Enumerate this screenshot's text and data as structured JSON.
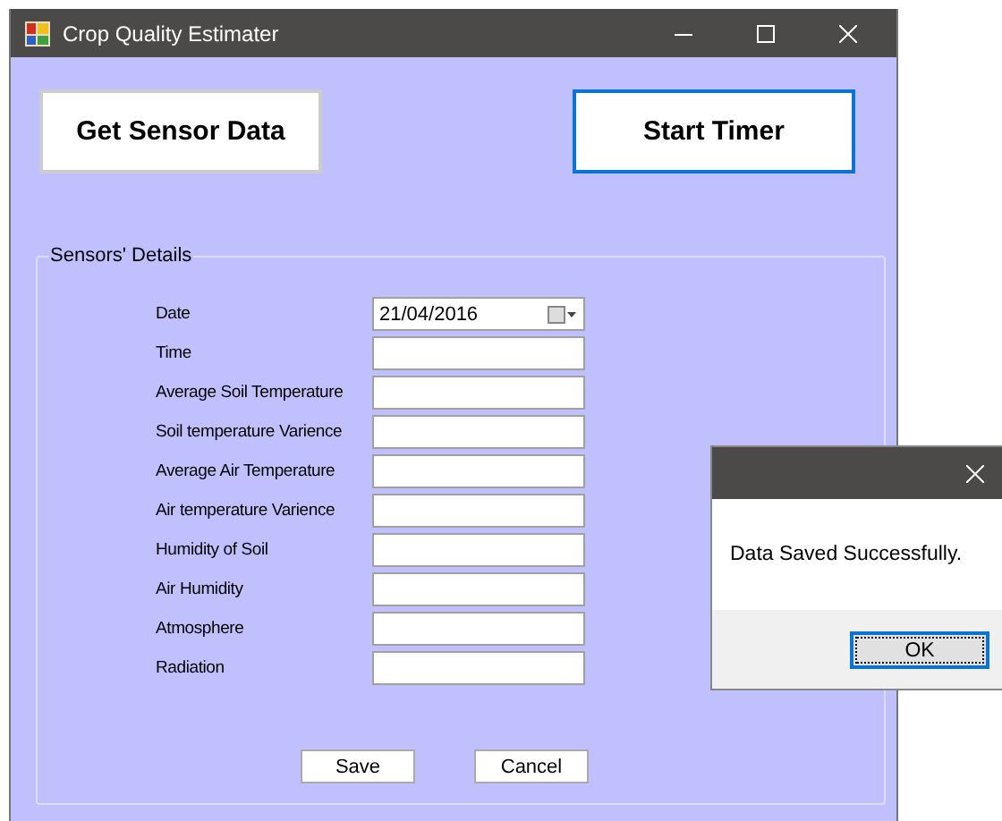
{
  "window": {
    "title": "Crop Quality Estimater"
  },
  "top_buttons": [
    {
      "label": "Get Sensor Data",
      "focused": false
    },
    {
      "label": "Start Timer",
      "focused": true
    }
  ],
  "group": {
    "title": "Sensors' Details",
    "fields": [
      {
        "label": "Date",
        "kind": "date",
        "value": "21/04/2016"
      },
      {
        "label": "Time",
        "kind": "text"
      },
      {
        "label": "Average Soil Temperature",
        "kind": "text"
      },
      {
        "label": "Soil temperature Varience",
        "kind": "text"
      },
      {
        "label": "Average Air Temperature",
        "kind": "text"
      },
      {
        "label": "Air temperature Varience",
        "kind": "text"
      },
      {
        "label": "Humidity of Soil",
        "kind": "text"
      },
      {
        "label": "Air Humidity",
        "kind": "text"
      },
      {
        "label": "Atmosphere",
        "kind": "text"
      },
      {
        "label": "Radiation",
        "kind": "text"
      }
    ],
    "buttons": [
      "Save",
      "Cancel"
    ]
  },
  "dialog": {
    "message": "Data Saved Successfully.",
    "button": "OK"
  }
}
